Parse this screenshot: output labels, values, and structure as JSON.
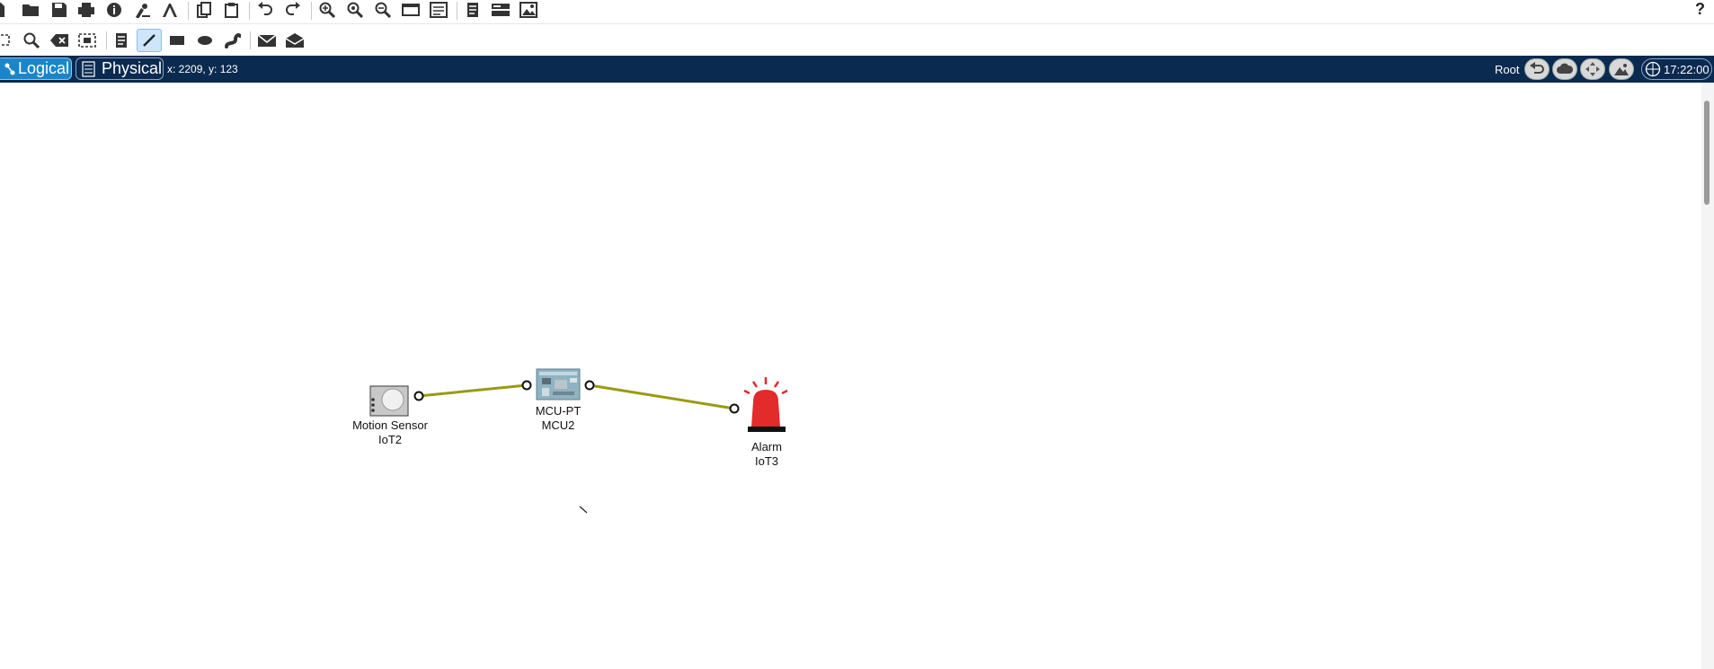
{
  "tabs": {
    "logical": "Logical",
    "physical": "Physical"
  },
  "status": {
    "coords": "x: 2209, y: 123",
    "root": "Root",
    "time": "17:22:00"
  },
  "toolbar_main": [
    "new-file-icon",
    "open-folder-icon",
    "save-icon",
    "save-as-icon",
    "print-icon",
    "info-icon",
    "wizard-icon",
    "activity-wizard-icon",
    "copy-icon",
    "paste-icon",
    "undo-icon",
    "redo-icon",
    "zoom-in-icon",
    "zoom-reset-icon",
    "zoom-out-icon",
    "drawing-palette-icon",
    "custom-device-icon",
    "notes-icon",
    "viewport-icon",
    "image-icon"
  ],
  "toolbar_tools": [
    "select-icon",
    "inspect-icon",
    "delete-icon",
    "resize-icon",
    "note-icon",
    "draw-line-icon",
    "rectangle-icon",
    "ellipse-icon",
    "freeform-icon",
    "simple-pdu-icon",
    "complex-pdu-icon"
  ],
  "devices": [
    {
      "type": "Motion Sensor",
      "name": "IoT2"
    },
    {
      "type": "MCU-PT",
      "name": "MCU2"
    },
    {
      "type": "Alarm",
      "name": "IoT3"
    }
  ],
  "colors": {
    "link": "#9a9a14",
    "navbar": "#0b2a50",
    "logical_tab": "#1a86c9"
  }
}
